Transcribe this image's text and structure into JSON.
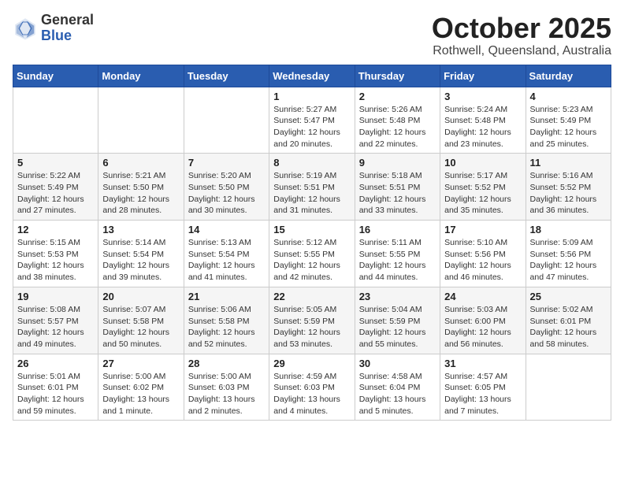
{
  "header": {
    "logo_general": "General",
    "logo_blue": "Blue",
    "month_title": "October 2025",
    "location": "Rothwell, Queensland, Australia"
  },
  "days_of_week": [
    "Sunday",
    "Monday",
    "Tuesday",
    "Wednesday",
    "Thursday",
    "Friday",
    "Saturday"
  ],
  "weeks": [
    [
      {
        "day": "",
        "info": ""
      },
      {
        "day": "",
        "info": ""
      },
      {
        "day": "",
        "info": ""
      },
      {
        "day": "1",
        "info": "Sunrise: 5:27 AM\nSunset: 5:47 PM\nDaylight: 12 hours and 20 minutes."
      },
      {
        "day": "2",
        "info": "Sunrise: 5:26 AM\nSunset: 5:48 PM\nDaylight: 12 hours and 22 minutes."
      },
      {
        "day": "3",
        "info": "Sunrise: 5:24 AM\nSunset: 5:48 PM\nDaylight: 12 hours and 23 minutes."
      },
      {
        "day": "4",
        "info": "Sunrise: 5:23 AM\nSunset: 5:49 PM\nDaylight: 12 hours and 25 minutes."
      }
    ],
    [
      {
        "day": "5",
        "info": "Sunrise: 5:22 AM\nSunset: 5:49 PM\nDaylight: 12 hours and 27 minutes."
      },
      {
        "day": "6",
        "info": "Sunrise: 5:21 AM\nSunset: 5:50 PM\nDaylight: 12 hours and 28 minutes."
      },
      {
        "day": "7",
        "info": "Sunrise: 5:20 AM\nSunset: 5:50 PM\nDaylight: 12 hours and 30 minutes."
      },
      {
        "day": "8",
        "info": "Sunrise: 5:19 AM\nSunset: 5:51 PM\nDaylight: 12 hours and 31 minutes."
      },
      {
        "day": "9",
        "info": "Sunrise: 5:18 AM\nSunset: 5:51 PM\nDaylight: 12 hours and 33 minutes."
      },
      {
        "day": "10",
        "info": "Sunrise: 5:17 AM\nSunset: 5:52 PM\nDaylight: 12 hours and 35 minutes."
      },
      {
        "day": "11",
        "info": "Sunrise: 5:16 AM\nSunset: 5:52 PM\nDaylight: 12 hours and 36 minutes."
      }
    ],
    [
      {
        "day": "12",
        "info": "Sunrise: 5:15 AM\nSunset: 5:53 PM\nDaylight: 12 hours and 38 minutes."
      },
      {
        "day": "13",
        "info": "Sunrise: 5:14 AM\nSunset: 5:54 PM\nDaylight: 12 hours and 39 minutes."
      },
      {
        "day": "14",
        "info": "Sunrise: 5:13 AM\nSunset: 5:54 PM\nDaylight: 12 hours and 41 minutes."
      },
      {
        "day": "15",
        "info": "Sunrise: 5:12 AM\nSunset: 5:55 PM\nDaylight: 12 hours and 42 minutes."
      },
      {
        "day": "16",
        "info": "Sunrise: 5:11 AM\nSunset: 5:55 PM\nDaylight: 12 hours and 44 minutes."
      },
      {
        "day": "17",
        "info": "Sunrise: 5:10 AM\nSunset: 5:56 PM\nDaylight: 12 hours and 46 minutes."
      },
      {
        "day": "18",
        "info": "Sunrise: 5:09 AM\nSunset: 5:56 PM\nDaylight: 12 hours and 47 minutes."
      }
    ],
    [
      {
        "day": "19",
        "info": "Sunrise: 5:08 AM\nSunset: 5:57 PM\nDaylight: 12 hours and 49 minutes."
      },
      {
        "day": "20",
        "info": "Sunrise: 5:07 AM\nSunset: 5:58 PM\nDaylight: 12 hours and 50 minutes."
      },
      {
        "day": "21",
        "info": "Sunrise: 5:06 AM\nSunset: 5:58 PM\nDaylight: 12 hours and 52 minutes."
      },
      {
        "day": "22",
        "info": "Sunrise: 5:05 AM\nSunset: 5:59 PM\nDaylight: 12 hours and 53 minutes."
      },
      {
        "day": "23",
        "info": "Sunrise: 5:04 AM\nSunset: 5:59 PM\nDaylight: 12 hours and 55 minutes."
      },
      {
        "day": "24",
        "info": "Sunrise: 5:03 AM\nSunset: 6:00 PM\nDaylight: 12 hours and 56 minutes."
      },
      {
        "day": "25",
        "info": "Sunrise: 5:02 AM\nSunset: 6:01 PM\nDaylight: 12 hours and 58 minutes."
      }
    ],
    [
      {
        "day": "26",
        "info": "Sunrise: 5:01 AM\nSunset: 6:01 PM\nDaylight: 12 hours and 59 minutes."
      },
      {
        "day": "27",
        "info": "Sunrise: 5:00 AM\nSunset: 6:02 PM\nDaylight: 13 hours and 1 minute."
      },
      {
        "day": "28",
        "info": "Sunrise: 5:00 AM\nSunset: 6:03 PM\nDaylight: 13 hours and 2 minutes."
      },
      {
        "day": "29",
        "info": "Sunrise: 4:59 AM\nSunset: 6:03 PM\nDaylight: 13 hours and 4 minutes."
      },
      {
        "day": "30",
        "info": "Sunrise: 4:58 AM\nSunset: 6:04 PM\nDaylight: 13 hours and 5 minutes."
      },
      {
        "day": "31",
        "info": "Sunrise: 4:57 AM\nSunset: 6:05 PM\nDaylight: 13 hours and 7 minutes."
      },
      {
        "day": "",
        "info": ""
      }
    ]
  ]
}
